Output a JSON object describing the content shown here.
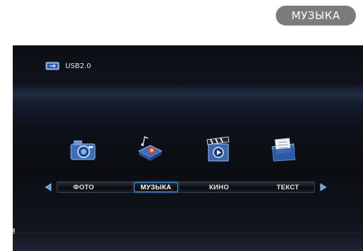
{
  "header": {
    "section_label": "МУЗЫКА"
  },
  "screen": {
    "device": {
      "label": "USB2.0",
      "icon": "usb-drive-icon"
    },
    "media_icons": [
      {
        "name": "photo-camera-icon"
      },
      {
        "name": "music-projector-icon"
      },
      {
        "name": "movie-clapper-icon"
      },
      {
        "name": "text-documents-icon"
      }
    ],
    "menu": {
      "items": [
        {
          "label": "ФОТО",
          "selected": false
        },
        {
          "label": "МУЗЫКА",
          "selected": true
        },
        {
          "label": "КИНО",
          "selected": false
        },
        {
          "label": "ТЕКСТ",
          "selected": false
        }
      ],
      "left_arrow_icon": "arrow-left-icon",
      "right_arrow_icon": "arrow-right-icon",
      "selection_color": "#2f8fe0"
    }
  }
}
